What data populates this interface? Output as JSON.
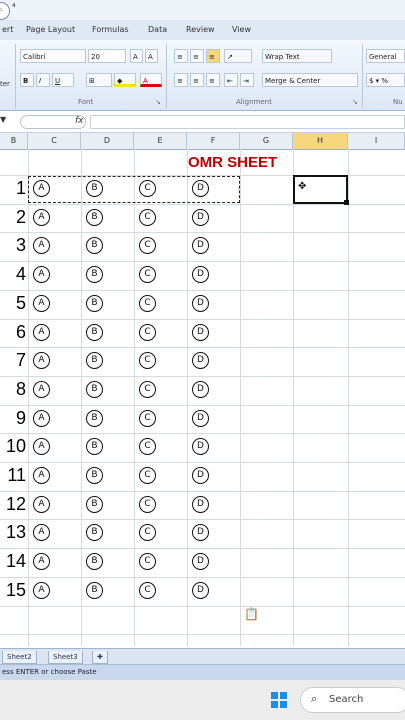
{
  "titlebar": {
    "text": "⁴"
  },
  "tabs": [
    "ert",
    "Page Layout",
    "Formulas",
    "Data",
    "Review",
    "View"
  ],
  "ribbon": {
    "font_name": "Calibri",
    "font_size": "20",
    "wrap_text": "Wrap Text",
    "merge_center": "Merge & Center",
    "number_format": "General",
    "paste_label": "ter",
    "font_group": "Font",
    "alignment_group": "Alignment",
    "number_group": "Nu"
  },
  "formula_bar": {
    "fx": "fx",
    "value": ""
  },
  "columns": [
    "B",
    "C",
    "D",
    "E",
    "F",
    "G",
    "H",
    "I"
  ],
  "sheet": {
    "title": "OMR SHEET",
    "rows": [
      "1",
      "2",
      "3",
      "4",
      "5",
      "6",
      "7",
      "8",
      "9",
      "10",
      "11",
      "12",
      "13",
      "14",
      "15"
    ],
    "options": [
      "A",
      "B",
      "C",
      "D"
    ]
  },
  "sheet_tabs": [
    "Sheet2",
    "Sheet3"
  ],
  "status": "ess ENTER or choose Paste",
  "taskbar": {
    "search_placeholder": "Search"
  }
}
